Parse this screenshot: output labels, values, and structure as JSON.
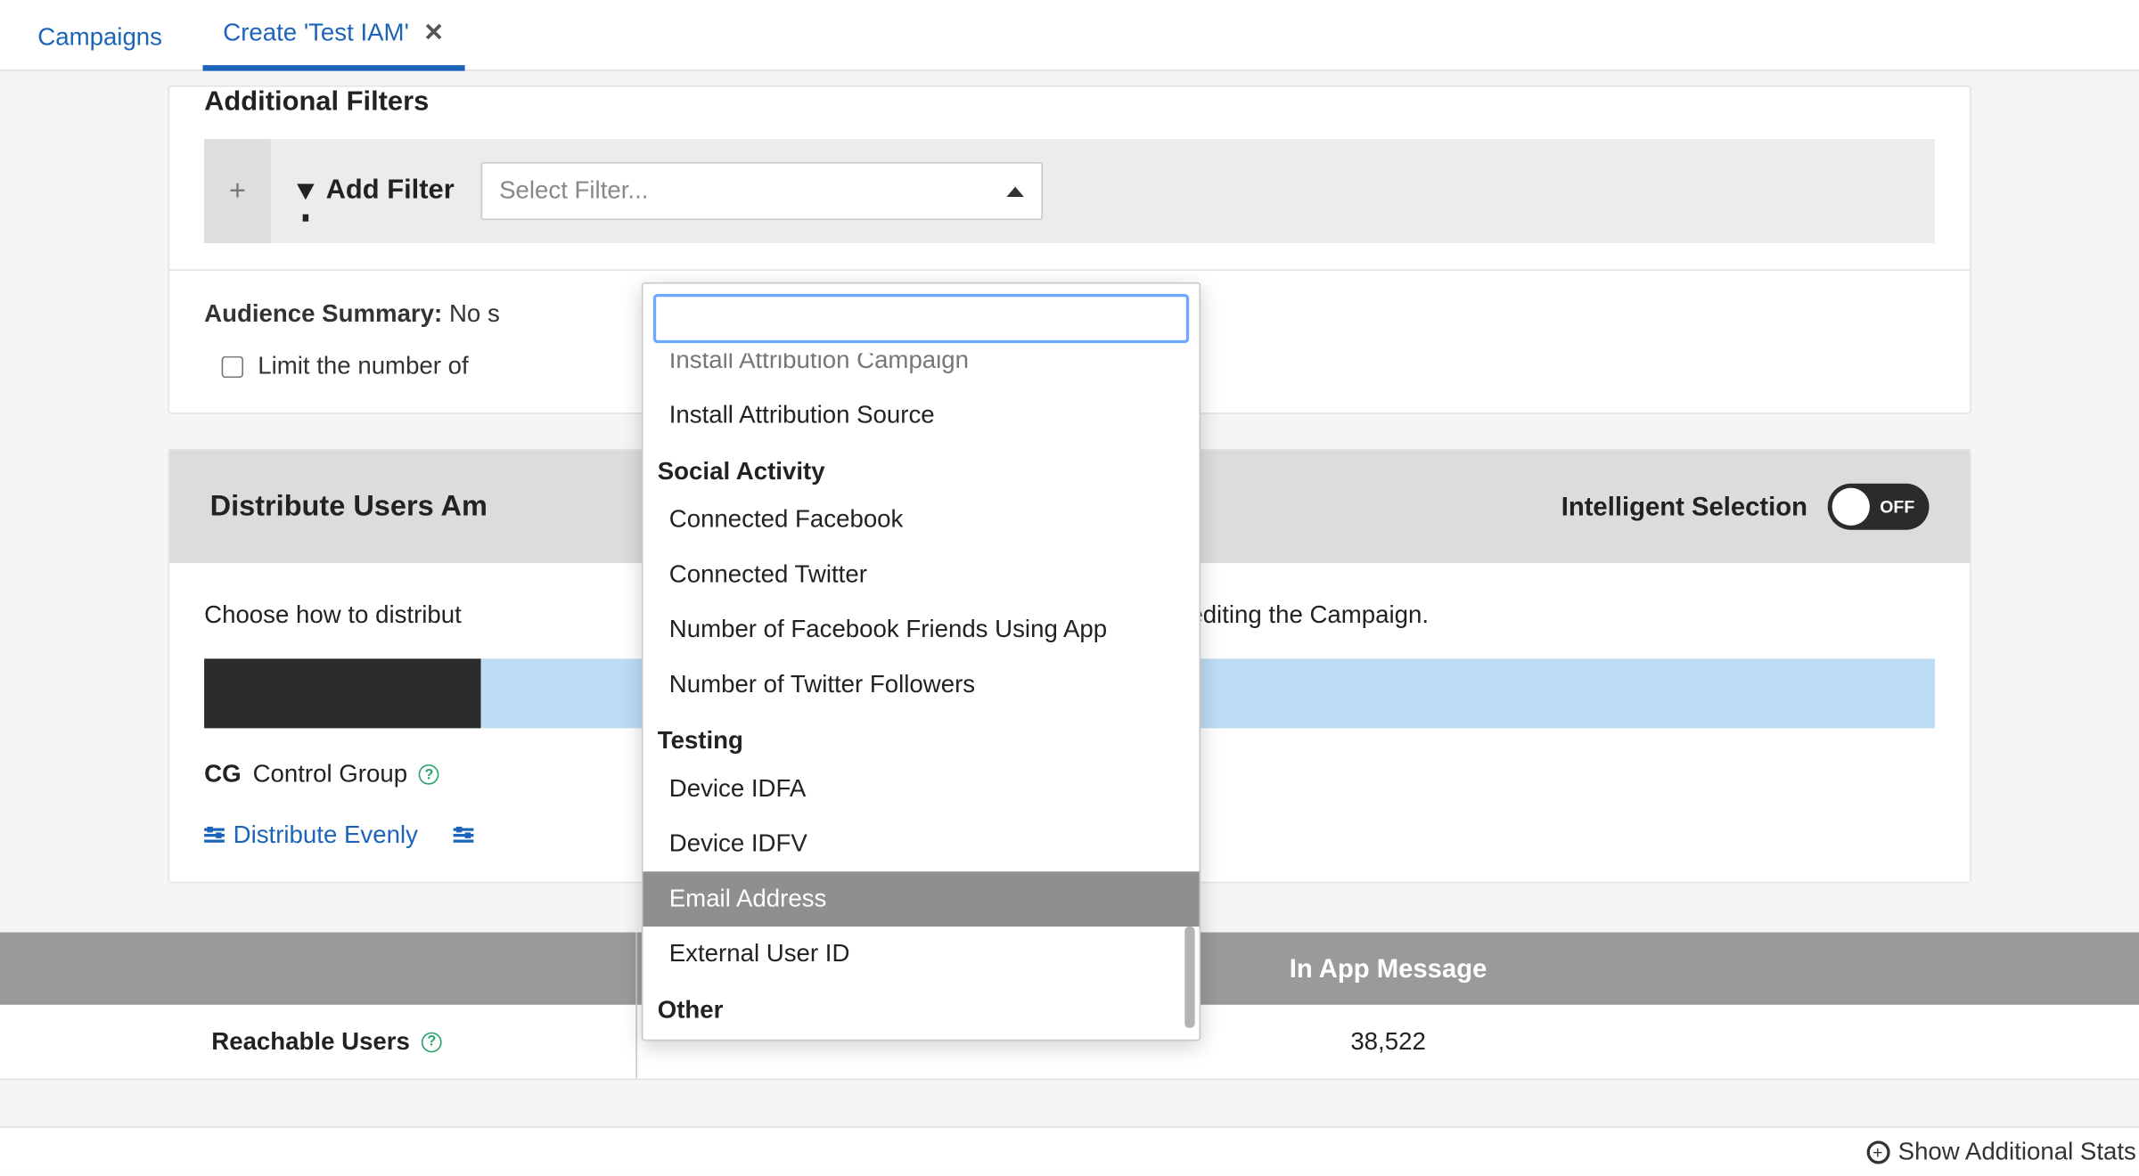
{
  "tabs": {
    "campaigns": "Campaigns",
    "create": "Create 'Test IAM'",
    "close_glyph": "✕"
  },
  "filters": {
    "heading": "Additional Filters",
    "add_label": "Add Filter",
    "plus": "+",
    "select_placeholder": "Select Filter..."
  },
  "dropdown": {
    "partial_top": "Install Attribution Campaign",
    "items": [
      {
        "t": "opt",
        "v": "Install Attribution Source"
      },
      {
        "t": "grp",
        "v": "Social Activity"
      },
      {
        "t": "opt",
        "v": "Connected Facebook"
      },
      {
        "t": "opt",
        "v": "Connected Twitter"
      },
      {
        "t": "opt",
        "v": "Number of Facebook Friends Using App"
      },
      {
        "t": "opt",
        "v": "Number of Twitter Followers"
      },
      {
        "t": "grp",
        "v": "Testing"
      },
      {
        "t": "opt",
        "v": "Device IDFA"
      },
      {
        "t": "opt",
        "v": "Device IDFV"
      },
      {
        "t": "opt",
        "v": "Email Address",
        "sel": true
      },
      {
        "t": "opt",
        "v": "External User ID"
      },
      {
        "t": "grp",
        "v": "Other"
      }
    ]
  },
  "summary": {
    "label": "Audience Summary:",
    "value_prefix": "No s"
  },
  "limit": {
    "label": "Limit the number of"
  },
  "distribute": {
    "header": "Distribute Users Am",
    "toggle_label": "Intelligent Selection",
    "toggle_state": "OFF",
    "explain_left": "Choose how to distribut",
    "explain_right": "anged later by editing the Campaign.",
    "cg_code": "CG",
    "cg_label": "Control Group",
    "link_evenly": "Distribute Evenly"
  },
  "stats": {
    "col_right_header": "In App Message",
    "row_label": "Reachable Users",
    "row_value": "38,522"
  },
  "footer": {
    "show_additional": "Show Additional Stats"
  },
  "colors": {
    "link": "#1c64b8",
    "panel_border": "#e3e3e3",
    "dropdown_sel": "#8f8f8f",
    "bar_dark": "#2b2b2b",
    "bar_light": "#bcdcf4"
  }
}
